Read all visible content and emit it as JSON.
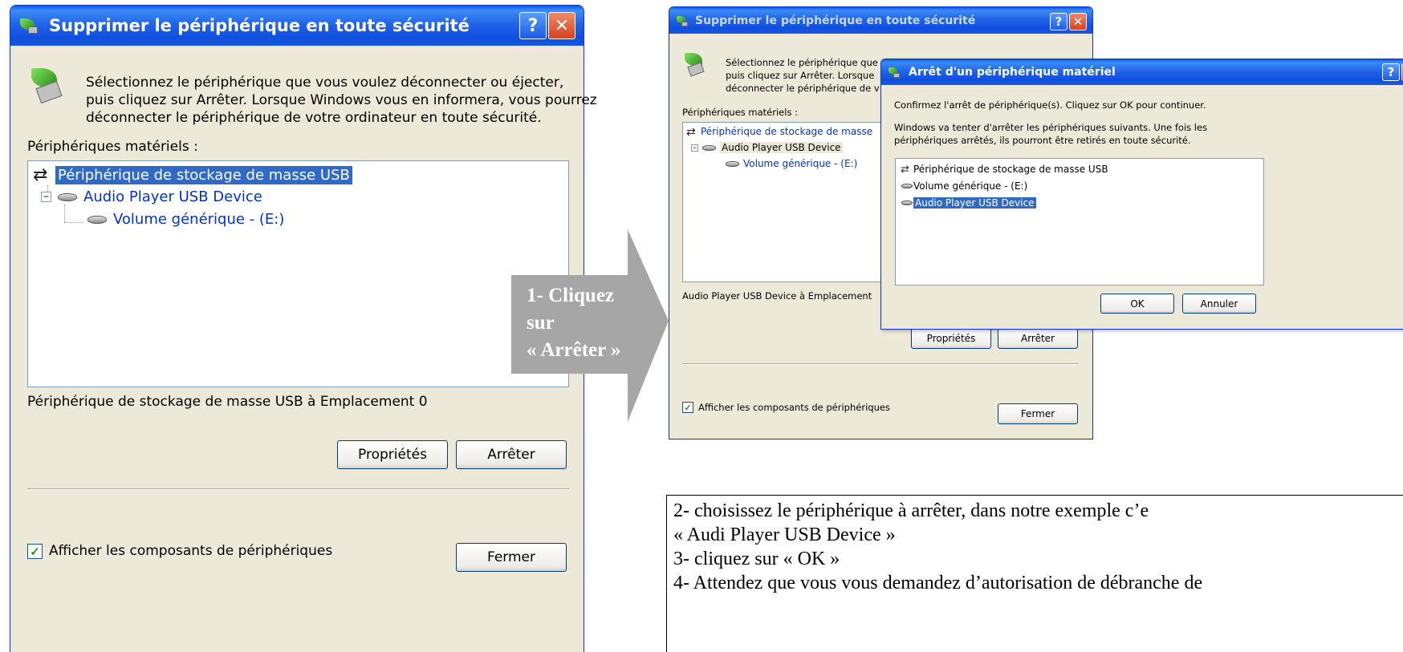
{
  "dialog_main": {
    "title": "Supprimer le périphérique en toute sécurité",
    "help_glyph": "?",
    "close_glyph": "✕",
    "instructions": [
      "Sélectionnez le périphérique que vous voulez déconnecter ou éjecter,",
      "puis cliquez sur Arrêter. Lorsque Windows vous en informera, vous pourrez",
      "déconnecter le périphérique de votre ordinateur en toute sécurité."
    ],
    "hardware_label": "Périphériques matériels :",
    "tree": {
      "root": "Périphérique de stockage de masse USB",
      "child": "Audio Player USB Device",
      "grandchild": "Volume générique - (E:)"
    },
    "status": "Périphérique de stockage de masse USB à Emplacement 0",
    "properties_button": "Propriétés",
    "stop_button": "Arrêter",
    "show_components_label": "Afficher les composants de périphériques",
    "show_components_checked": true,
    "close_button": "Fermer"
  },
  "arrow_annotation": {
    "line1": "1- Cliquez",
    "line2": "sur",
    "line3": "« Arrêter »"
  },
  "dialog_small": {
    "title": "Supprimer le périphérique en toute sécurité",
    "help_glyph": "?",
    "close_glyph": "✕",
    "instructions_partial": [
      "Sélectionnez le périphérique que",
      "puis cliquez sur Arrêter. Lorsque",
      "déconnecter le périphérique de v"
    ],
    "hardware_label": "Périphériques matériels :",
    "tree": {
      "root": "Périphérique de stockage de masse",
      "child": "Audio Player USB Device",
      "grandchild": "Volume générique - (E:)"
    },
    "status_partial": "Audio Player USB Device à Emplacement",
    "properties_button": "Propriétés",
    "stop_button": "Arrêter",
    "show_components_label": "Afficher les composants de périphériques",
    "close_button": "Fermer"
  },
  "dialog_stop": {
    "title": "Arrêt d'un périphérique matériel",
    "help_glyph": "?",
    "close_glyph": "✕",
    "confirm_text": "Confirmez l'arrêt de périphérique(s). Cliquez sur OK pour continuer.",
    "info_text_1": "Windows va tenter d'arrêter les périphériques suivants. Une fois les",
    "info_text_2": "périphériques arrêtés, ils pourront être retirés en toute sécurité.",
    "devices": [
      "Périphérique de stockage de masse USB",
      "Volume générique - (E:)",
      "Audio Player USB Device"
    ],
    "selected_device_index": 2,
    "ok_button": "OK",
    "cancel_button": "Annuler"
  },
  "instructions_box": {
    "line1": "2-  choisissez le périphérique à arrêter, dans notre exemple c’e",
    "line2": "«  Audi Player USB Device »",
    "line3": "3-  cliquez sur « OK »",
    "line4_partial": "4-  Attendez que vous vous demandez d’autorisation de débranche de"
  },
  "colors": {
    "xp_title_blue": "#0a5ae8",
    "dialog_face": "#ece9d8",
    "selection_blue": "#316ac5",
    "link_blue": "#0033cc",
    "arrow_gray": "#a6a6a6"
  }
}
